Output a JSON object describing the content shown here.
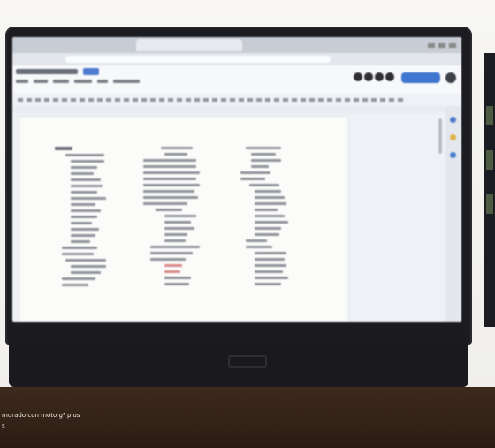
{
  "scene": {
    "caption_line1": "murado con moto g³ plus",
    "caption_line2": "s",
    "colors": {
      "laptop_bezel": "#1c1c20",
      "screen_bg": "#eef1f6",
      "share_button": "#3a76d8",
      "desk": "#3e2a1d"
    }
  },
  "screen_content": {
    "browser_tab": "",
    "document": {
      "title": "",
      "share_label": "",
      "toolbar_icons": [
        "undo-icon",
        "redo-icon",
        "print-icon",
        "bold-icon",
        "italic-icon",
        "underline-icon",
        "link-icon",
        "list-icon"
      ],
      "side_panel_icons": [
        "calendar-icon",
        "keep-icon",
        "tasks-icon"
      ]
    }
  }
}
